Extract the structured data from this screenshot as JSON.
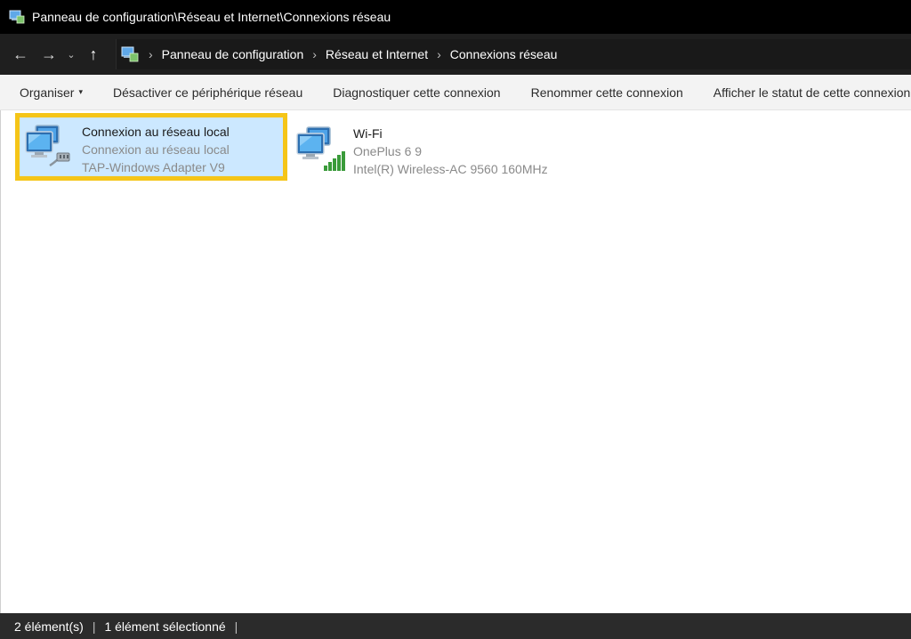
{
  "window": {
    "title": "Panneau de configuration\\Réseau et Internet\\Connexions réseau"
  },
  "navigation": {
    "back_icon": "←",
    "forward_icon": "→",
    "recent_icon": "⌄",
    "up_icon": "↑",
    "separator": "›",
    "breadcrumbs": [
      "Panneau de configuration",
      "Réseau et Internet",
      "Connexions réseau"
    ]
  },
  "toolbar": {
    "organize": "Organiser",
    "organize_caret": "▾",
    "disable": "Désactiver ce périphérique réseau",
    "diagnose": "Diagnostiquer cette connexion",
    "rename": "Renommer cette connexion",
    "status": "Afficher le statut de cette connexion"
  },
  "connections": [
    {
      "name": "Connexion au réseau local",
      "network": "Connexion au réseau local",
      "adapter": "TAP-Windows Adapter V9",
      "icon": "network-cable-icon",
      "selected": true
    },
    {
      "name": "Wi-Fi",
      "network": "OnePlus 6 9",
      "adapter": "Intel(R) Wireless-AC 9560 160MHz",
      "icon": "wifi-signal-icon",
      "selected": false
    }
  ],
  "statusbar": {
    "count": "2 élément(s)",
    "separator": "|",
    "selection": "1 élément sélectionné"
  },
  "colors": {
    "selection_bg": "#cce8ff",
    "highlight_border": "#f5c518",
    "titlebar_bg": "#000000",
    "statusbar_bg": "#2b2b2b"
  }
}
